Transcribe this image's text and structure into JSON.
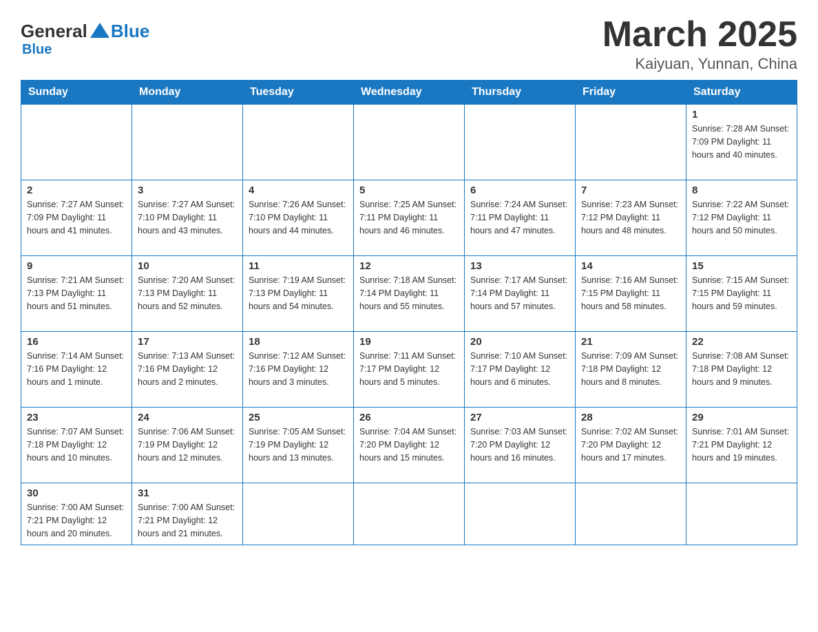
{
  "header": {
    "logo_general": "General",
    "logo_blue": "Blue",
    "month_title": "March 2025",
    "location": "Kaiyuan, Yunnan, China"
  },
  "weekdays": [
    "Sunday",
    "Monday",
    "Tuesday",
    "Wednesday",
    "Thursday",
    "Friday",
    "Saturday"
  ],
  "rows": [
    [
      {
        "day": "",
        "info": ""
      },
      {
        "day": "",
        "info": ""
      },
      {
        "day": "",
        "info": ""
      },
      {
        "day": "",
        "info": ""
      },
      {
        "day": "",
        "info": ""
      },
      {
        "day": "",
        "info": ""
      },
      {
        "day": "1",
        "info": "Sunrise: 7:28 AM\nSunset: 7:09 PM\nDaylight: 11 hours and 40 minutes."
      }
    ],
    [
      {
        "day": "2",
        "info": "Sunrise: 7:27 AM\nSunset: 7:09 PM\nDaylight: 11 hours and 41 minutes."
      },
      {
        "day": "3",
        "info": "Sunrise: 7:27 AM\nSunset: 7:10 PM\nDaylight: 11 hours and 43 minutes."
      },
      {
        "day": "4",
        "info": "Sunrise: 7:26 AM\nSunset: 7:10 PM\nDaylight: 11 hours and 44 minutes."
      },
      {
        "day": "5",
        "info": "Sunrise: 7:25 AM\nSunset: 7:11 PM\nDaylight: 11 hours and 46 minutes."
      },
      {
        "day": "6",
        "info": "Sunrise: 7:24 AM\nSunset: 7:11 PM\nDaylight: 11 hours and 47 minutes."
      },
      {
        "day": "7",
        "info": "Sunrise: 7:23 AM\nSunset: 7:12 PM\nDaylight: 11 hours and 48 minutes."
      },
      {
        "day": "8",
        "info": "Sunrise: 7:22 AM\nSunset: 7:12 PM\nDaylight: 11 hours and 50 minutes."
      }
    ],
    [
      {
        "day": "9",
        "info": "Sunrise: 7:21 AM\nSunset: 7:13 PM\nDaylight: 11 hours and 51 minutes."
      },
      {
        "day": "10",
        "info": "Sunrise: 7:20 AM\nSunset: 7:13 PM\nDaylight: 11 hours and 52 minutes."
      },
      {
        "day": "11",
        "info": "Sunrise: 7:19 AM\nSunset: 7:13 PM\nDaylight: 11 hours and 54 minutes."
      },
      {
        "day": "12",
        "info": "Sunrise: 7:18 AM\nSunset: 7:14 PM\nDaylight: 11 hours and 55 minutes."
      },
      {
        "day": "13",
        "info": "Sunrise: 7:17 AM\nSunset: 7:14 PM\nDaylight: 11 hours and 57 minutes."
      },
      {
        "day": "14",
        "info": "Sunrise: 7:16 AM\nSunset: 7:15 PM\nDaylight: 11 hours and 58 minutes."
      },
      {
        "day": "15",
        "info": "Sunrise: 7:15 AM\nSunset: 7:15 PM\nDaylight: 11 hours and 59 minutes."
      }
    ],
    [
      {
        "day": "16",
        "info": "Sunrise: 7:14 AM\nSunset: 7:16 PM\nDaylight: 12 hours and 1 minute."
      },
      {
        "day": "17",
        "info": "Sunrise: 7:13 AM\nSunset: 7:16 PM\nDaylight: 12 hours and 2 minutes."
      },
      {
        "day": "18",
        "info": "Sunrise: 7:12 AM\nSunset: 7:16 PM\nDaylight: 12 hours and 3 minutes."
      },
      {
        "day": "19",
        "info": "Sunrise: 7:11 AM\nSunset: 7:17 PM\nDaylight: 12 hours and 5 minutes."
      },
      {
        "day": "20",
        "info": "Sunrise: 7:10 AM\nSunset: 7:17 PM\nDaylight: 12 hours and 6 minutes."
      },
      {
        "day": "21",
        "info": "Sunrise: 7:09 AM\nSunset: 7:18 PM\nDaylight: 12 hours and 8 minutes."
      },
      {
        "day": "22",
        "info": "Sunrise: 7:08 AM\nSunset: 7:18 PM\nDaylight: 12 hours and 9 minutes."
      }
    ],
    [
      {
        "day": "23",
        "info": "Sunrise: 7:07 AM\nSunset: 7:18 PM\nDaylight: 12 hours and 10 minutes."
      },
      {
        "day": "24",
        "info": "Sunrise: 7:06 AM\nSunset: 7:19 PM\nDaylight: 12 hours and 12 minutes."
      },
      {
        "day": "25",
        "info": "Sunrise: 7:05 AM\nSunset: 7:19 PM\nDaylight: 12 hours and 13 minutes."
      },
      {
        "day": "26",
        "info": "Sunrise: 7:04 AM\nSunset: 7:20 PM\nDaylight: 12 hours and 15 minutes."
      },
      {
        "day": "27",
        "info": "Sunrise: 7:03 AM\nSunset: 7:20 PM\nDaylight: 12 hours and 16 minutes."
      },
      {
        "day": "28",
        "info": "Sunrise: 7:02 AM\nSunset: 7:20 PM\nDaylight: 12 hours and 17 minutes."
      },
      {
        "day": "29",
        "info": "Sunrise: 7:01 AM\nSunset: 7:21 PM\nDaylight: 12 hours and 19 minutes."
      }
    ],
    [
      {
        "day": "30",
        "info": "Sunrise: 7:00 AM\nSunset: 7:21 PM\nDaylight: 12 hours and 20 minutes."
      },
      {
        "day": "31",
        "info": "Sunrise: 7:00 AM\nSunset: 7:21 PM\nDaylight: 12 hours and 21 minutes."
      },
      {
        "day": "",
        "info": ""
      },
      {
        "day": "",
        "info": ""
      },
      {
        "day": "",
        "info": ""
      },
      {
        "day": "",
        "info": ""
      },
      {
        "day": "",
        "info": ""
      }
    ]
  ]
}
